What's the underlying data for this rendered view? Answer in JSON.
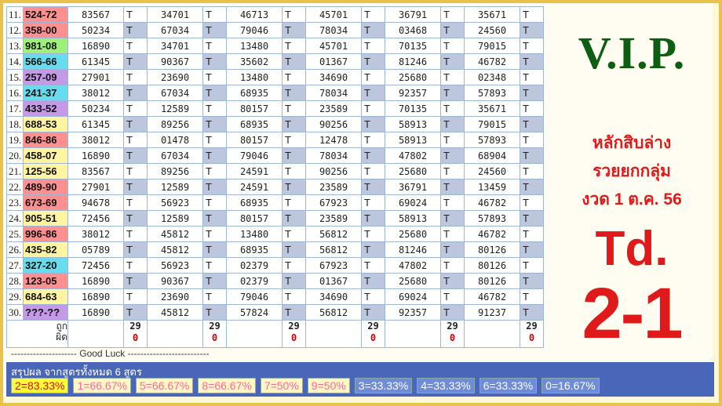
{
  "rows": [
    {
      "n": "11.",
      "key": "524-72",
      "color": "#ff9090",
      "cells": [
        "83567",
        "34701",
        "46713",
        "45701",
        "36791",
        "35671"
      ],
      "hits": [
        false,
        true,
        false,
        true,
        false,
        false
      ]
    },
    {
      "n": "12.",
      "key": "358-00",
      "color": "#ff9090",
      "cells": [
        "50234",
        "67034",
        "79046",
        "78034",
        "03468",
        "24560"
      ],
      "hits": [
        false,
        false,
        false,
        false,
        false,
        false
      ]
    },
    {
      "n": "13.",
      "key": "981-08",
      "color": "#9ef07a",
      "cells": [
        "16890",
        "34701",
        "13480",
        "45701",
        "70135",
        "79015"
      ],
      "hits": [
        false,
        false,
        false,
        false,
        false,
        false
      ]
    },
    {
      "n": "14.",
      "key": "566-66",
      "color": "#66ddee",
      "cells": [
        "61345",
        "90367",
        "35602",
        "01367",
        "81246",
        "46782"
      ],
      "hits": [
        false,
        false,
        false,
        false,
        false,
        false
      ]
    },
    {
      "n": "15.",
      "key": "257-09",
      "color": "#c49ae8",
      "cells": [
        "27901",
        "23690",
        "13480",
        "34690",
        "25680",
        "02348"
      ],
      "hits": [
        false,
        true,
        false,
        false,
        false,
        false
      ]
    },
    {
      "n": "16.",
      "key": "241-37",
      "color": "#66ddee",
      "cells": [
        "38012",
        "67034",
        "68935",
        "78034",
        "92357",
        "57893"
      ],
      "hits": [
        false,
        false,
        false,
        false,
        false,
        false
      ]
    },
    {
      "n": "17.",
      "key": "433-52",
      "color": "#c49ae8",
      "cells": [
        "50234",
        "12589",
        "80157",
        "23589",
        "70135",
        "35671"
      ],
      "hits": [
        false,
        false,
        false,
        false,
        false,
        false
      ]
    },
    {
      "n": "18.",
      "key": "688-53",
      "color": "#fff4a0",
      "cells": [
        "61345",
        "89256",
        "68935",
        "90256",
        "58913",
        "79015"
      ],
      "hits": [
        false,
        false,
        false,
        false,
        false,
        false
      ]
    },
    {
      "n": "19.",
      "key": "846-86",
      "color": "#ff9090",
      "cells": [
        "38012",
        "01478",
        "80157",
        "12478",
        "58913",
        "57893"
      ],
      "hits": [
        false,
        false,
        false,
        false,
        false,
        false
      ]
    },
    {
      "n": "20.",
      "key": "458-07",
      "color": "#fff4a0",
      "cells": [
        "16890",
        "67034",
        "79046",
        "78034",
        "47802",
        "68904"
      ],
      "hits": [
        false,
        false,
        false,
        false,
        false,
        false
      ]
    },
    {
      "n": "21.",
      "key": "125-56",
      "color": "#fff4a0",
      "cells": [
        "83567",
        "89256",
        "24591",
        "90256",
        "25680",
        "24560"
      ],
      "hits": [
        false,
        false,
        false,
        false,
        false,
        false
      ]
    },
    {
      "n": "22.",
      "key": "489-90",
      "color": "#ff9090",
      "cells": [
        "27901",
        "12589",
        "24591",
        "23589",
        "36791",
        "13459"
      ],
      "hits": [
        false,
        false,
        false,
        false,
        false,
        false
      ]
    },
    {
      "n": "23.",
      "key": "673-69",
      "color": "#ff9090",
      "cells": [
        "94678",
        "56923",
        "68935",
        "67923",
        "69024",
        "46782"
      ],
      "hits": [
        false,
        false,
        false,
        false,
        false,
        false
      ]
    },
    {
      "n": "24.",
      "key": "905-51",
      "color": "#fff4a0",
      "cells": [
        "72456",
        "12589",
        "80157",
        "23589",
        "58913",
        "57893"
      ],
      "hits": [
        false,
        false,
        false,
        false,
        false,
        false
      ]
    },
    {
      "n": "25.",
      "key": "996-86",
      "color": "#ff9090",
      "cells": [
        "38012",
        "45812",
        "13480",
        "56812",
        "25680",
        "46782"
      ],
      "hits": [
        false,
        false,
        false,
        false,
        false,
        false
      ]
    },
    {
      "n": "26.",
      "key": "435-82",
      "color": "#fff4a0",
      "cells": [
        "05789",
        "45812",
        "68935",
        "56812",
        "81246",
        "80126"
      ],
      "hits": [
        false,
        false,
        false,
        false,
        false,
        false
      ]
    },
    {
      "n": "27.",
      "key": "327-20",
      "color": "#66ddee",
      "cells": [
        "72456",
        "56923",
        "02379",
        "67923",
        "47802",
        "80126"
      ],
      "hits": [
        false,
        false,
        false,
        false,
        false,
        false
      ]
    },
    {
      "n": "28.",
      "key": "123-05",
      "color": "#ff9090",
      "cells": [
        "16890",
        "90367",
        "02379",
        "01367",
        "25680",
        "80126"
      ],
      "hits": [
        false,
        false,
        false,
        false,
        false,
        false
      ]
    },
    {
      "n": "29.",
      "key": "684-63",
      "color": "#fff4a0",
      "cells": [
        "16890",
        "23690",
        "79046",
        "34690",
        "69024",
        "46782"
      ],
      "hits": [
        false,
        false,
        false,
        false,
        false,
        false
      ]
    },
    {
      "n": "30.",
      "key": "???-??",
      "color": "#c49ae8",
      "cells": [
        "16890",
        "45812",
        "57824",
        "56812",
        "92357",
        "91237"
      ],
      "hits": [
        false,
        false,
        false,
        false,
        false,
        false
      ]
    }
  ],
  "t_label": "T",
  "footer": {
    "label_right": "ถูก",
    "label_wrong": "ผิด",
    "counts": [
      {
        "right": "29",
        "wrong": "0"
      },
      {
        "right": "29",
        "wrong": "0"
      },
      {
        "right": "29",
        "wrong": "0"
      },
      {
        "right": "29",
        "wrong": "0"
      },
      {
        "right": "29",
        "wrong": "0"
      },
      {
        "right": "29",
        "wrong": "0"
      }
    ]
  },
  "luck": "--------------------- Good Luck --------------------------",
  "side": {
    "vip": "V.I.P.",
    "line1": "หลักสิบล่าง",
    "line2": "รวยยกกลุ่ม",
    "line3": "งวด 1 ต.ค. 56",
    "td": "Td.",
    "big": "2-1"
  },
  "summary": {
    "title": "สรุปผล จากสูตรทั้งหมด 6 สูตร",
    "chips": [
      {
        "text": "2=83.33%",
        "bg": "#ffff33",
        "fg": "#d01010"
      },
      {
        "text": "1=66.67%",
        "bg": "#fff8c0",
        "fg": "#ff66aa"
      },
      {
        "text": "5=66.67%",
        "bg": "#fff8c0",
        "fg": "#ff66aa"
      },
      {
        "text": "8=66.67%",
        "bg": "#fff8c0",
        "fg": "#ff66aa"
      },
      {
        "text": "7=50%",
        "bg": "#fff8c0",
        "fg": "#ff66aa"
      },
      {
        "text": "9=50%",
        "bg": "#fff8c0",
        "fg": "#ff66aa"
      },
      {
        "text": "3=33.33%",
        "bg": "#6f8cd8",
        "fg": "#ffffff"
      },
      {
        "text": "4=33.33%",
        "bg": "#6f8cd8",
        "fg": "#ffffff"
      },
      {
        "text": "6=33.33%",
        "bg": "#6f8cd8",
        "fg": "#ffffff"
      },
      {
        "text": "0=16.67%",
        "bg": "#6f8cd8",
        "fg": "#ffffff"
      }
    ]
  }
}
